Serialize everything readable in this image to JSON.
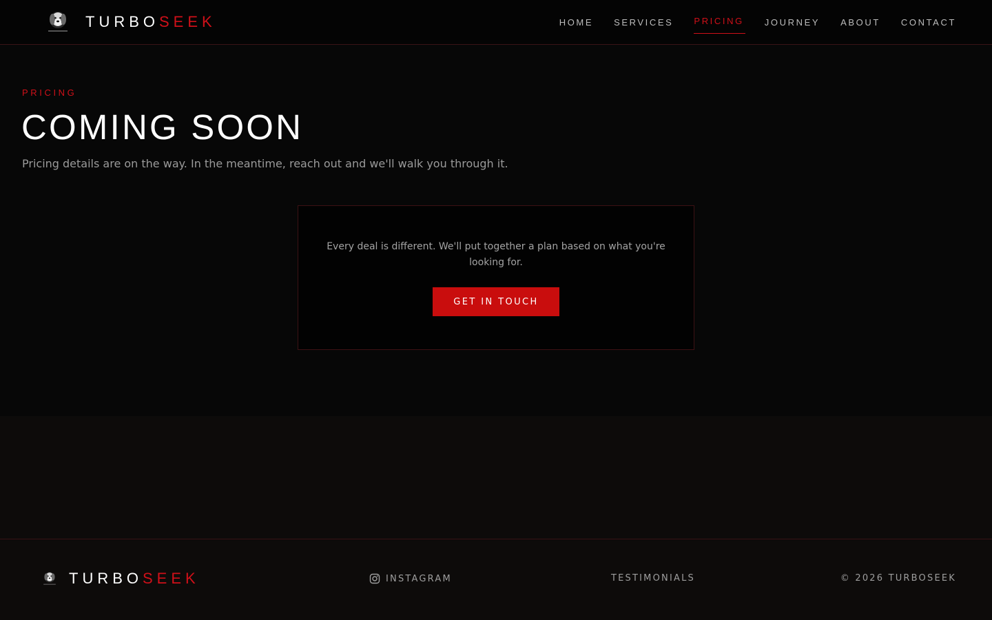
{
  "brand": {
    "name_part1": "TURBO",
    "name_part2": "SEEK",
    "logo_icon": "dog-head-logo-icon"
  },
  "nav": {
    "items": [
      {
        "label": "HOME"
      },
      {
        "label": "SERVICES"
      },
      {
        "label": "PRICING",
        "active": true
      },
      {
        "label": "JOURNEY"
      },
      {
        "label": "ABOUT"
      },
      {
        "label": "CONTACT"
      }
    ]
  },
  "hero": {
    "eyebrow": "PRICING",
    "title": "COMING SOON",
    "subtitle": "Pricing details are on the way. In the meantime, reach out and we'll walk you through it."
  },
  "card": {
    "text": "Every deal is different. We'll put together a plan based on what you're looking for.",
    "cta_label": "GET IN TOUCH"
  },
  "footer": {
    "instagram_label": "INSTAGRAM",
    "instagram_icon": "instagram-icon",
    "testimonials_label": "TESTIMONIALS",
    "copyright": "© 2026 TURBOSEEK"
  },
  "colors": {
    "accent": "#d01019",
    "button": "#c90d0d",
    "background": "#070707",
    "footer_bg": "#0d0b0a",
    "border": "#3a1416"
  }
}
